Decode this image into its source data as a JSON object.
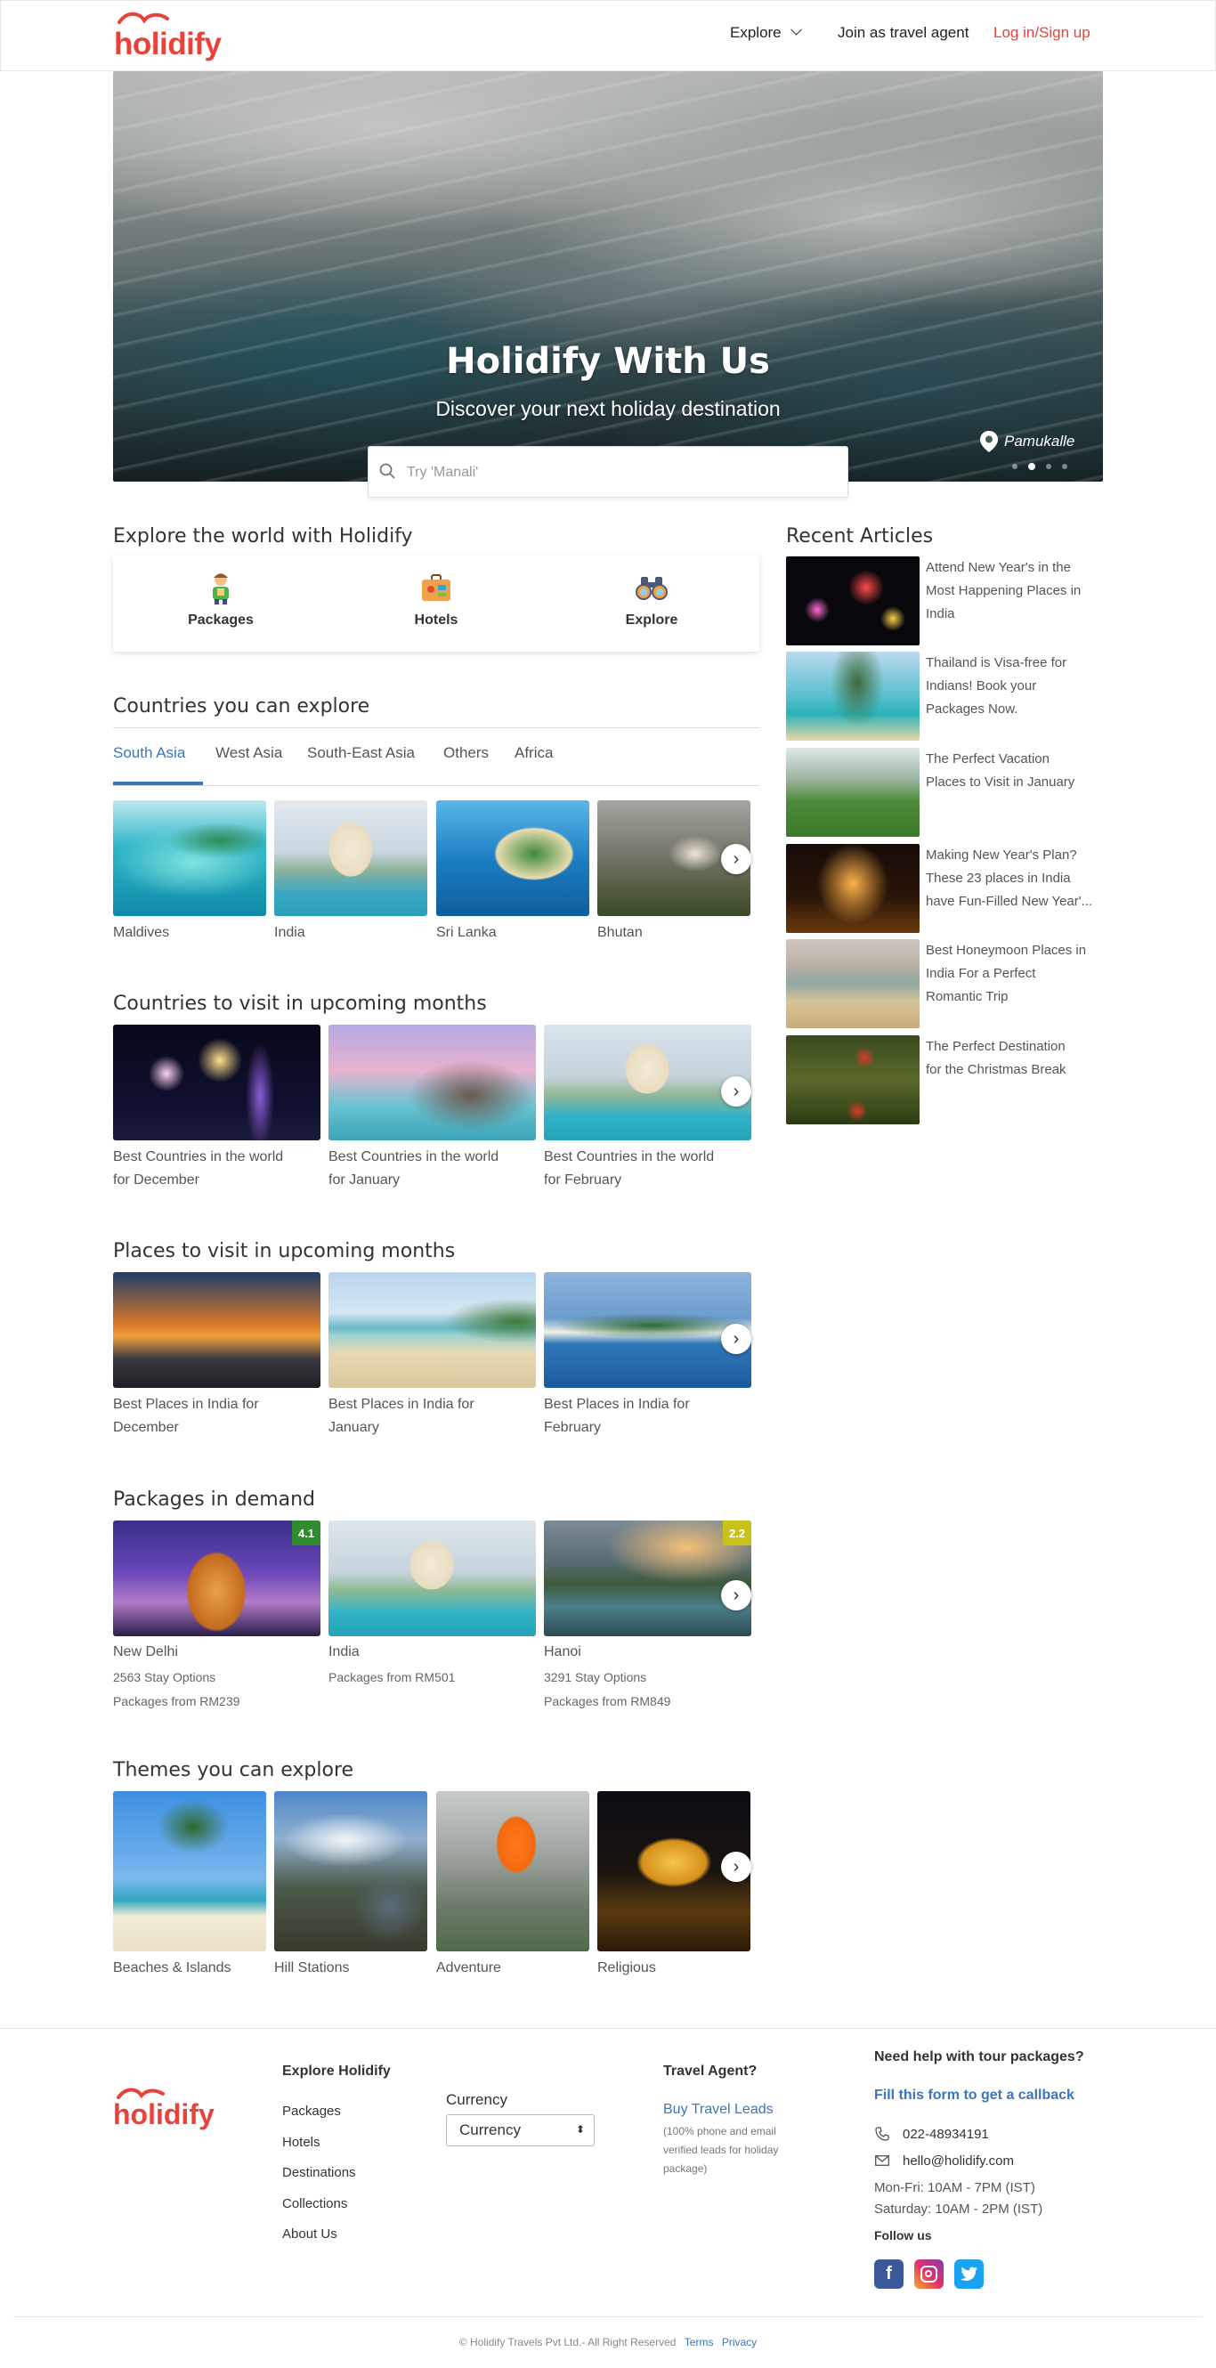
{
  "header": {
    "logo": "holidify",
    "nav": {
      "explore": "Explore",
      "agent": "Join as travel agent",
      "login": "Log in/Sign up"
    }
  },
  "hero": {
    "title": "Holidify With Us",
    "subtitle": "Discover your next holiday destination",
    "location": "Pamukalle",
    "search_placeholder": "Try 'Manali'",
    "slide_index": 2,
    "slide_count": 4
  },
  "explore": {
    "title": "Explore the world with Holidify",
    "items": [
      {
        "label": "Packages",
        "icon": "traveler-icon"
      },
      {
        "label": "Hotels",
        "icon": "suitcase-icon"
      },
      {
        "label": "Explore",
        "icon": "binoculars-icon"
      }
    ]
  },
  "countries": {
    "title": "Countries you can explore",
    "tabs": [
      "South Asia",
      "West Asia",
      "South-East Asia",
      "Others",
      "Africa"
    ],
    "active_tab": "South Asia",
    "items": [
      "Maldives",
      "India",
      "Sri Lanka",
      "Bhutan"
    ]
  },
  "upcoming_countries": {
    "title": "Countries to visit in upcoming months",
    "items": [
      {
        "line1": "Best Countries in the world",
        "line2": "for December"
      },
      {
        "line1": "Best Countries in the world",
        "line2": "for January"
      },
      {
        "line1": "Best Countries in the world",
        "line2": "for February"
      }
    ]
  },
  "upcoming_places": {
    "title": "Places to visit in upcoming months",
    "items": [
      {
        "line1": "Best Places in India for",
        "line2": "December"
      },
      {
        "line1": "Best Places in India for",
        "line2": "January"
      },
      {
        "line1": "Best Places in India for",
        "line2": "February"
      }
    ]
  },
  "packages": {
    "title": "Packages in demand",
    "items": [
      {
        "name": "New Delhi",
        "stay": "2563 Stay Options",
        "price": "Packages from RM239",
        "rating": "4.1",
        "rating_color": "#2e8b2e"
      },
      {
        "name": "India",
        "stay": "Packages from RM501",
        "price": "",
        "rating": "",
        "rating_color": ""
      },
      {
        "name": "Hanoi",
        "stay": "3291 Stay Options",
        "price": "Packages from RM849",
        "rating": "2.2",
        "rating_color": "#c8c21c"
      }
    ]
  },
  "themes": {
    "title": "Themes you can explore",
    "items": [
      "Beaches & Islands",
      "Hill Stations",
      "Adventure",
      "Religious"
    ]
  },
  "articles": {
    "title": "Recent Articles",
    "items": [
      {
        "lines": [
          "Attend New Year's in the",
          "Most Happening Places in",
          "India"
        ]
      },
      {
        "lines": [
          "Thailand is Visa-free for",
          "Indians! Book your",
          "Packages Now."
        ]
      },
      {
        "lines": [
          "The Perfect Vacation",
          "Places to Visit in January"
        ]
      },
      {
        "lines": [
          "Making New Year's Plan?",
          "These 23 places in India",
          "have Fun-Filled New Year'..."
        ]
      },
      {
        "lines": [
          "Best Honeymoon Places in",
          "India For a Perfect",
          "Romantic Trip"
        ]
      },
      {
        "lines": [
          "The Perfect Destination",
          "for the Christmas Break"
        ]
      }
    ]
  },
  "footer": {
    "logo": "holidify",
    "explore_title": "Explore Holidify",
    "links": [
      "Packages",
      "Hotels",
      "Destinations",
      "Collections",
      "About Us"
    ],
    "currency_label": "Currency",
    "currency_value": "Currency",
    "agent_title": "Travel Agent?",
    "agent_link": "Buy Travel Leads",
    "agent_note": [
      "(100% phone and email",
      "verified leads for holiday",
      "package)"
    ],
    "help_title": "Need help with tour packages?",
    "help_link": "Fill this form to get a callback",
    "phone": "022-48934191",
    "email": "hello@holidify.com",
    "hours1": "Mon-Fri: 10AM - 7PM (IST)",
    "hours2": "Saturday: 10AM - 2PM (IST)",
    "follow": "Follow us",
    "social": [
      "facebook-icon",
      "instagram-icon",
      "twitter-icon"
    ],
    "copyright": "© Holidify Travels Pvt Ltd.- All Right Reserved",
    "terms": "Terms",
    "privacy": "Privacy"
  },
  "colors": {
    "brand": "#e8423b",
    "accent": "#3a76b8"
  }
}
